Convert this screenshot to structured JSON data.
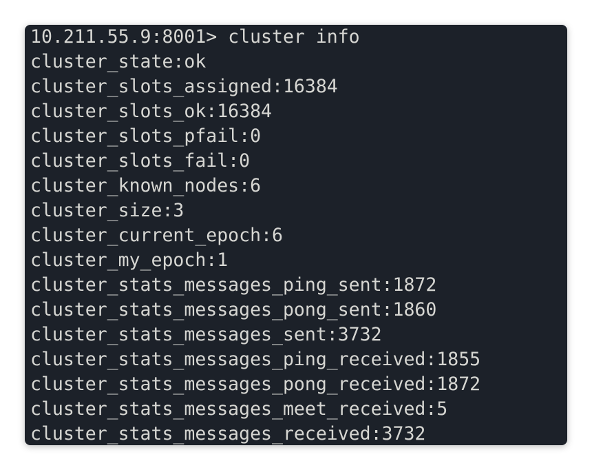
{
  "terminal": {
    "prompt": "10.211.55.9:8001> ",
    "command": "cluster info",
    "output": [
      "cluster_state:ok",
      "cluster_slots_assigned:16384",
      "cluster_slots_ok:16384",
      "cluster_slots_pfail:0",
      "cluster_slots_fail:0",
      "cluster_known_nodes:6",
      "cluster_size:3",
      "cluster_current_epoch:6",
      "cluster_my_epoch:1",
      "cluster_stats_messages_ping_sent:1872",
      "cluster_stats_messages_pong_sent:1860",
      "cluster_stats_messages_sent:3732",
      "cluster_stats_messages_ping_received:1855",
      "cluster_stats_messages_pong_received:1872",
      "cluster_stats_messages_meet_received:5",
      "cluster_stats_messages_received:3732"
    ]
  },
  "colors": {
    "background": "#1c2129",
    "text": "#d6d6d2"
  }
}
